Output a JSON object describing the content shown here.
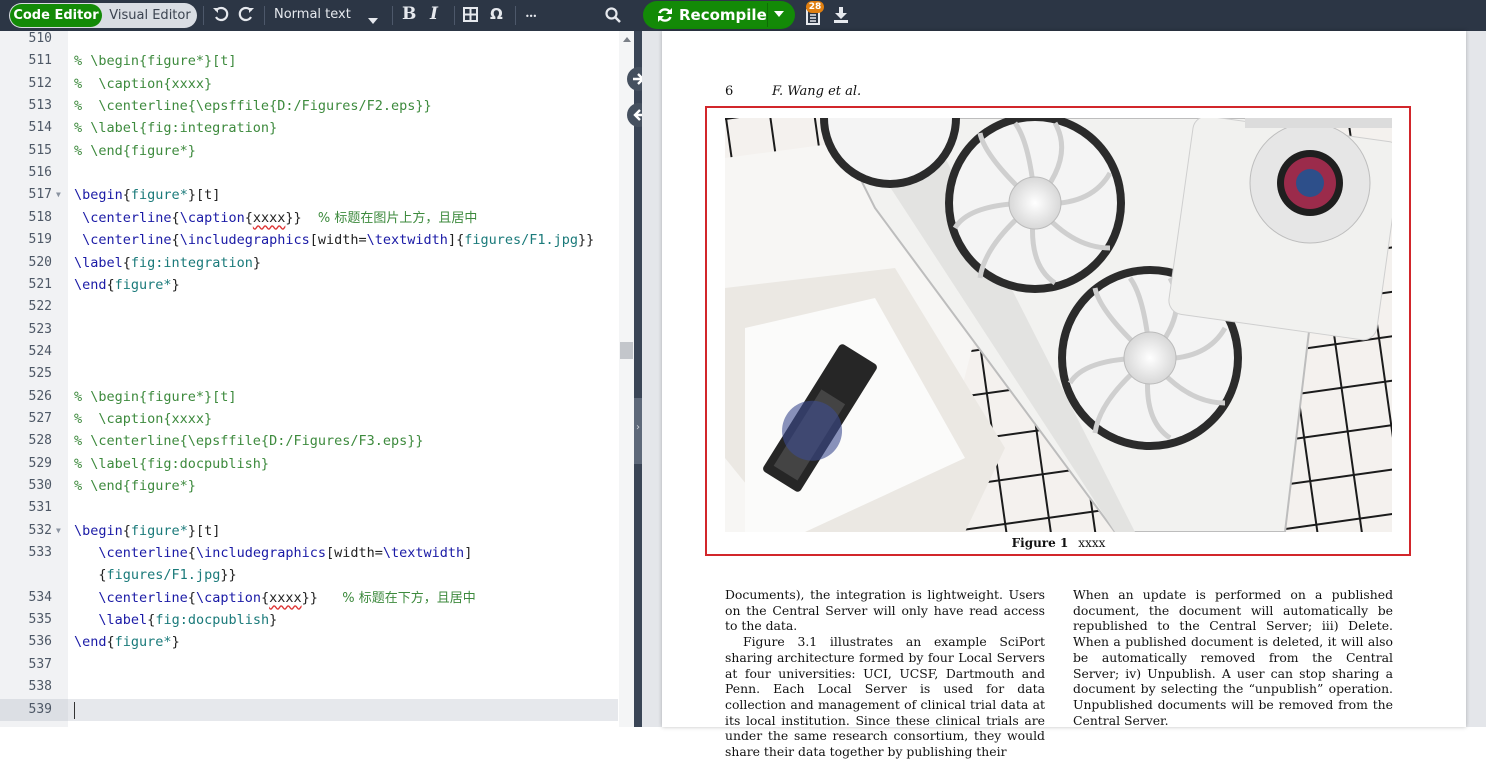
{
  "toolbar": {
    "code_editor_label": "Code Editor",
    "visual_editor_label": "Visual Editor",
    "style_select_value": "Normal text",
    "bold_glyph": "B",
    "italic_glyph": "I",
    "omega_glyph": "Ω",
    "more_glyph": "•••",
    "recompile_label": "Recompile",
    "log_badge_count": "28",
    "accent_color": "#138a07",
    "icons": [
      "undo-icon",
      "redo-icon",
      "caret-down-icon",
      "table-icon",
      "search-icon",
      "refresh-icon",
      "log-icon",
      "download-icon"
    ]
  },
  "editor": {
    "current_line": "539",
    "lines": [
      {
        "n": "510",
        "text": ""
      },
      {
        "n": "511",
        "text": "% \\begin{figure*}[t]"
      },
      {
        "n": "512",
        "text": "%  \\caption{xxxx}"
      },
      {
        "n": "513",
        "text": "%  \\centerline{\\epsffile{D:/Figures/F2.eps}}"
      },
      {
        "n": "514",
        "text": "% \\label{fig:integration}"
      },
      {
        "n": "515",
        "text": "% \\end{figure*}"
      },
      {
        "n": "516",
        "text": ""
      },
      {
        "n": "517",
        "text": "\\begin{figure*}[t]"
      },
      {
        "n": "518",
        "text": " \\centerline{\\caption{xxxx}}  % 标题在图片上方，且居中"
      },
      {
        "n": "519",
        "text": " \\centerline{\\includegraphics[width=\\textwidth]{figures/F1.jpg}}"
      },
      {
        "n": "520",
        "text": "\\label{fig:integration}"
      },
      {
        "n": "521",
        "text": "\\end{figure*}"
      },
      {
        "n": "522",
        "text": ""
      },
      {
        "n": "523",
        "text": ""
      },
      {
        "n": "524",
        "text": ""
      },
      {
        "n": "525",
        "text": ""
      },
      {
        "n": "526",
        "text": "% \\begin{figure*}[t]"
      },
      {
        "n": "527",
        "text": "%  \\caption{xxxx}"
      },
      {
        "n": "528",
        "text": "% \\centerline{\\epsffile{D:/Figures/F3.eps}}"
      },
      {
        "n": "529",
        "text": "% \\label{fig:docpublish}"
      },
      {
        "n": "530",
        "text": "% \\end{figure*}"
      },
      {
        "n": "531",
        "text": ""
      },
      {
        "n": "532",
        "text": "\\begin{figure*}[t]"
      },
      {
        "n": "533",
        "text": "   \\centerline{\\includegraphics[width=\\textwidth]"
      },
      {
        "n": "",
        "text": "   {figures/F1.jpg}}"
      },
      {
        "n": "534",
        "text": "   \\centerline{\\caption{xxxx}}   % 标题在下方，且居中"
      },
      {
        "n": "535",
        "text": "   \\label{fig:docpublish}"
      },
      {
        "n": "536",
        "text": "\\end{figure*}"
      },
      {
        "n": "537",
        "text": ""
      },
      {
        "n": "538",
        "text": ""
      },
      {
        "n": "539",
        "text": ""
      }
    ]
  },
  "pdf": {
    "page_number": "6",
    "running_head": "F. Wang et al.",
    "figure_label": "Figure 1",
    "figure_caption": "xxxx",
    "highlight_color": "#d2262b",
    "col1": [
      "Documents), the integration is lightweight. Users on the Central Server will only have read access to the data.",
      "Figure 3.1 illustrates an example SciPort sharing architecture formed by four Local Servers at four universities: UCI, UCSF, Dartmouth and Penn. Each Local Server is used for data collection and management of clinical trial data at its local institution. Since these clinical trials are under the same research consortium, they would share their data together by publishing their"
    ],
    "col2": "When an update is performed on a published document, the document will automatically be republished to the Central Server; iii) Delete. When a published document is deleted, it will also be automatically removed from the Central Server; iv) Unpublish. A user can stop sharing a document by selecting the “unpublish” operation. Unpublished documents will be removed from the Central Server."
  }
}
